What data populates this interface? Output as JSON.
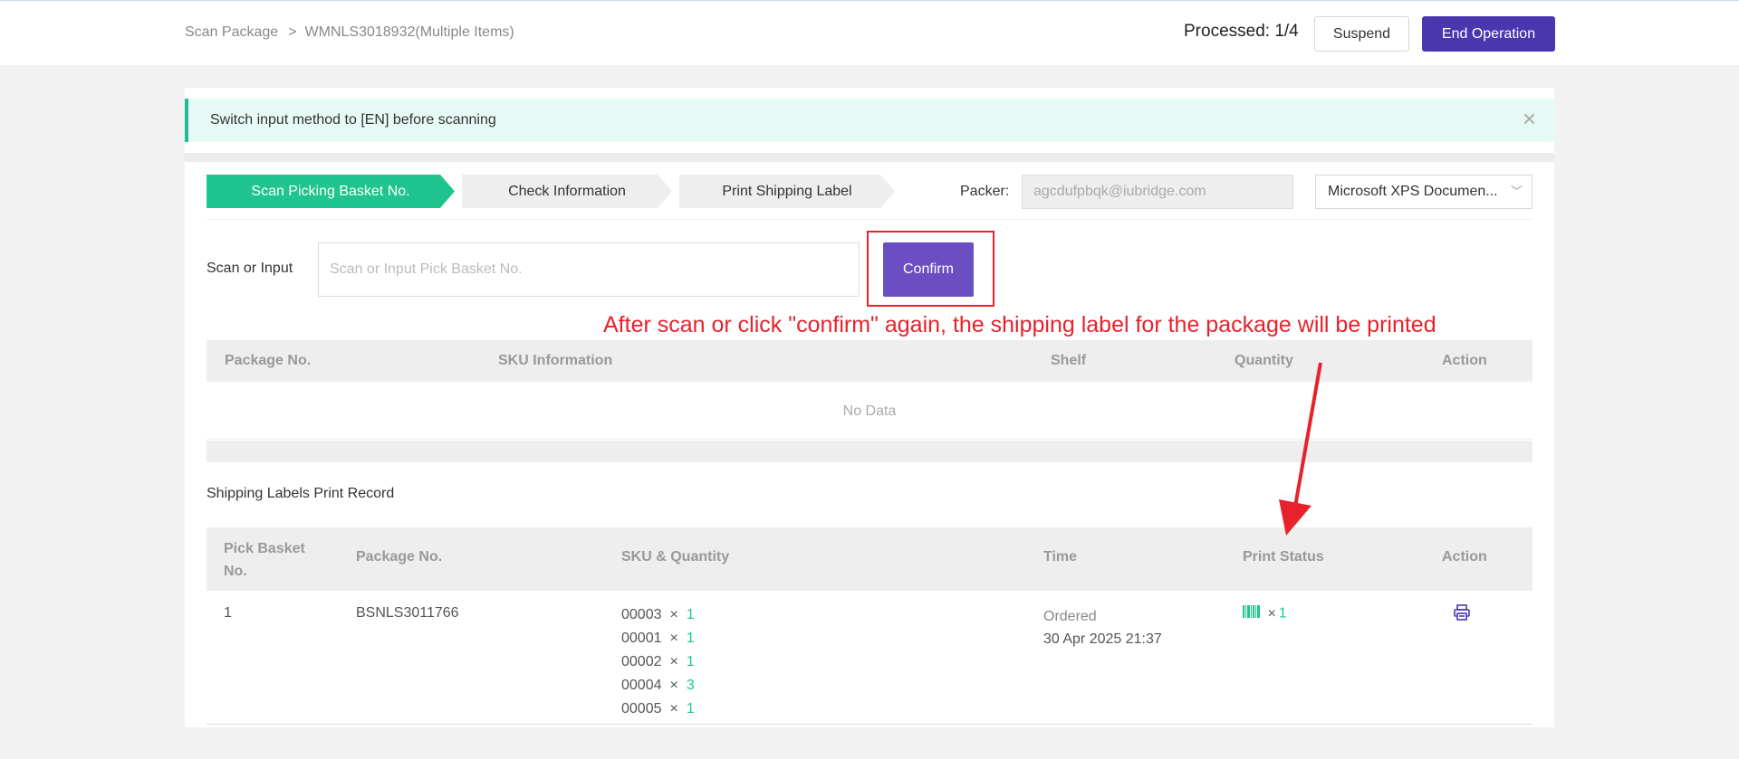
{
  "breadcrumb": {
    "root": "Scan Package",
    "separator": ">",
    "current": "WMNLS3018932(Multiple Items)"
  },
  "header": {
    "processed": "Processed: 1/4",
    "suspend_label": "Suspend",
    "end_label": "End Operation"
  },
  "alert": {
    "text": "Switch input method to [EN] before scanning",
    "close_glyph": "×"
  },
  "steps": [
    {
      "label": "Scan Picking Basket No."
    },
    {
      "label": "Check Information"
    },
    {
      "label": "Print Shipping Label"
    }
  ],
  "packer": {
    "label": "Packer:",
    "value": "agcdufpbqk@iubridge.com"
  },
  "printer": {
    "selected": "Microsoft XPS Documen...",
    "chevron": "﹀"
  },
  "scan": {
    "label": "Scan or Input",
    "placeholder": "Scan or Input Pick Basket No.",
    "confirm_label": "Confirm"
  },
  "annotation": {
    "text": "After scan or click \"confirm\" again, the shipping label for the package will be printed"
  },
  "package_table": {
    "headers": [
      "Package No.",
      "SKU Information",
      "Shelf",
      "Quantity",
      "Action"
    ],
    "empty_text": "No Data"
  },
  "record": {
    "title": "Shipping Labels Print Record",
    "headers": {
      "pick_basket_1": "Pick Basket",
      "pick_basket_2": "No.",
      "package_no": "Package No.",
      "sku_qty": "SKU & Quantity",
      "time": "Time",
      "print_status": "Print Status",
      "action": "Action"
    },
    "rows": [
      {
        "pick_basket": "1",
        "package_no": "BSNLS3011766",
        "skus": [
          {
            "sku": "00003",
            "qty": "1"
          },
          {
            "sku": "00001",
            "qty": "1"
          },
          {
            "sku": "00002",
            "qty": "1"
          },
          {
            "sku": "00004",
            "qty": "3"
          },
          {
            "sku": "00005",
            "qty": "1"
          }
        ],
        "time_status": "Ordered",
        "time": "30 Apr 2025 21:37",
        "print_count": "1",
        "times_glyph": "×"
      }
    ]
  },
  "icons": {
    "barcode": "barcode-icon",
    "printer": "printer-icon"
  },
  "colors": {
    "primary": "#4a37b0",
    "confirm": "#6b4ec2",
    "success": "#1fc48f",
    "alert_bg": "#e6fbf6",
    "annotation": "#e8222c"
  }
}
